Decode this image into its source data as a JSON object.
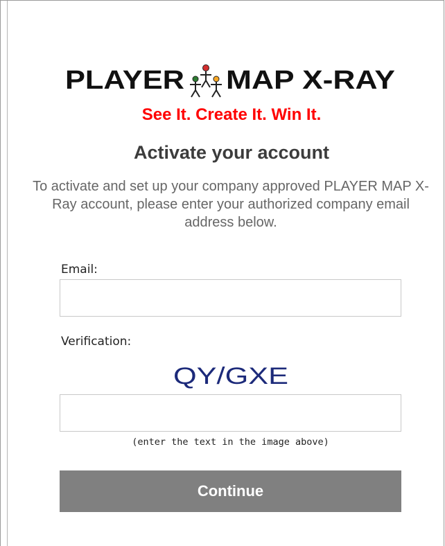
{
  "brand": {
    "logo_text_left": "PLAYER",
    "logo_text_right": "MAP X-RAY",
    "tagline": "See It. Create It. Win It.",
    "tagline_color": "#ff0000"
  },
  "page": {
    "heading": "Activate your account",
    "intro": "To activate and set up your company approved PLAYER MAP X-Ray account, please enter your authorized company email address below."
  },
  "form": {
    "email_label": "Email:",
    "email_value": "",
    "verification_label": "Verification:",
    "captcha_text": "QY/GXE",
    "captcha_color": "#1c2a7a",
    "verification_value": "",
    "verification_hint": "(enter the text in the image above)",
    "continue_label": "Continue",
    "button_color": "#808080"
  }
}
